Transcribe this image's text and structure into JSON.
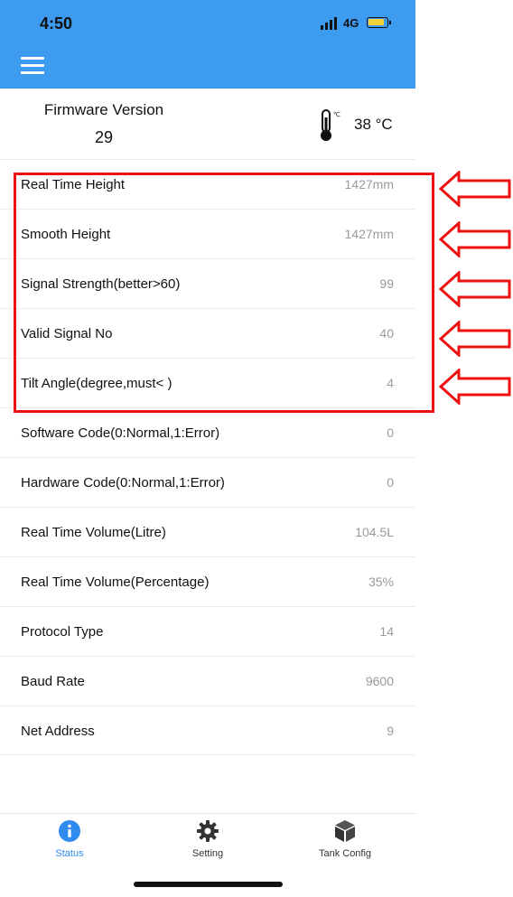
{
  "status_bar": {
    "time": "4:50",
    "network": "4G"
  },
  "header": {
    "menu_icon": "hamburger-menu-icon",
    "background": "#3d9bf0"
  },
  "firmware": {
    "label": "Firmware Version",
    "value": "29"
  },
  "temperature": {
    "icon": "thermometer-icon",
    "value": "38 °C"
  },
  "rows": [
    {
      "label": "Real Time Height",
      "value": "1427mm"
    },
    {
      "label": "Smooth Height",
      "value": "1427mm"
    },
    {
      "label": "Signal Strength(better>60)",
      "value": "99"
    },
    {
      "label": "Valid Signal No",
      "value": "40"
    },
    {
      "label": "Tilt Angle(degree,must<   )",
      "value": "4"
    },
    {
      "label": "Software Code(0:Normal,1:Error)",
      "value": "0"
    },
    {
      "label": "Hardware Code(0:Normal,1:Error)",
      "value": "0"
    },
    {
      "label": "Real Time Volume(Litre)",
      "value": "104.5L"
    },
    {
      "label": "Real Time Volume(Percentage)",
      "value": "35%"
    },
    {
      "label": "Protocol Type",
      "value": "14"
    },
    {
      "label": "Baud Rate",
      "value": "9600"
    },
    {
      "label": "Net Address",
      "value": "9"
    }
  ],
  "annotation": {
    "color": "#e11111",
    "arrow_icon": "left-arrow-icon"
  },
  "tabs": [
    {
      "label": "Status",
      "icon": "info-icon",
      "active": true
    },
    {
      "label": "Setting",
      "icon": "gear-icon",
      "active": false
    },
    {
      "label": "Tank Config",
      "icon": "cube-icon",
      "active": false
    }
  ],
  "accent": "#2f8cee"
}
